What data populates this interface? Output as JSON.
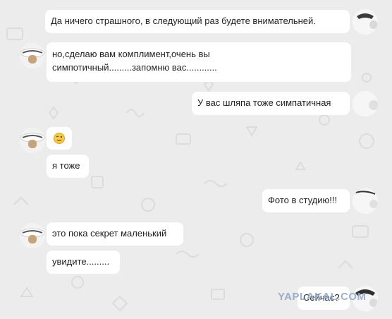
{
  "chat": {
    "messages": [
      {
        "side": "right",
        "text": "Да ничего страшного, в следующий раз будете внимательней."
      },
      {
        "side": "left",
        "text": "но,сделаю вам комплимент,очень вы"
      },
      {
        "side": "left",
        "text": "симпотичный.........запомню вас............"
      },
      {
        "side": "right",
        "text": "У вас шляпа тоже симпатичная"
      },
      {
        "side": "left",
        "emoji": "winking-face"
      },
      {
        "side": "left",
        "text": "я тоже"
      },
      {
        "side": "right",
        "text": "Фото в студию!!!"
      },
      {
        "side": "left",
        "text": "это пока секрет маленький"
      },
      {
        "side": "left",
        "text": "увидите........."
      },
      {
        "side": "right",
        "text": "Сейчас?"
      }
    ]
  },
  "colors": {
    "background": "#ececec",
    "bubble": "#ffffff",
    "text": "#222222",
    "watermark": "#8aa6c6"
  },
  "watermark": "YAPLAKAL.COM"
}
